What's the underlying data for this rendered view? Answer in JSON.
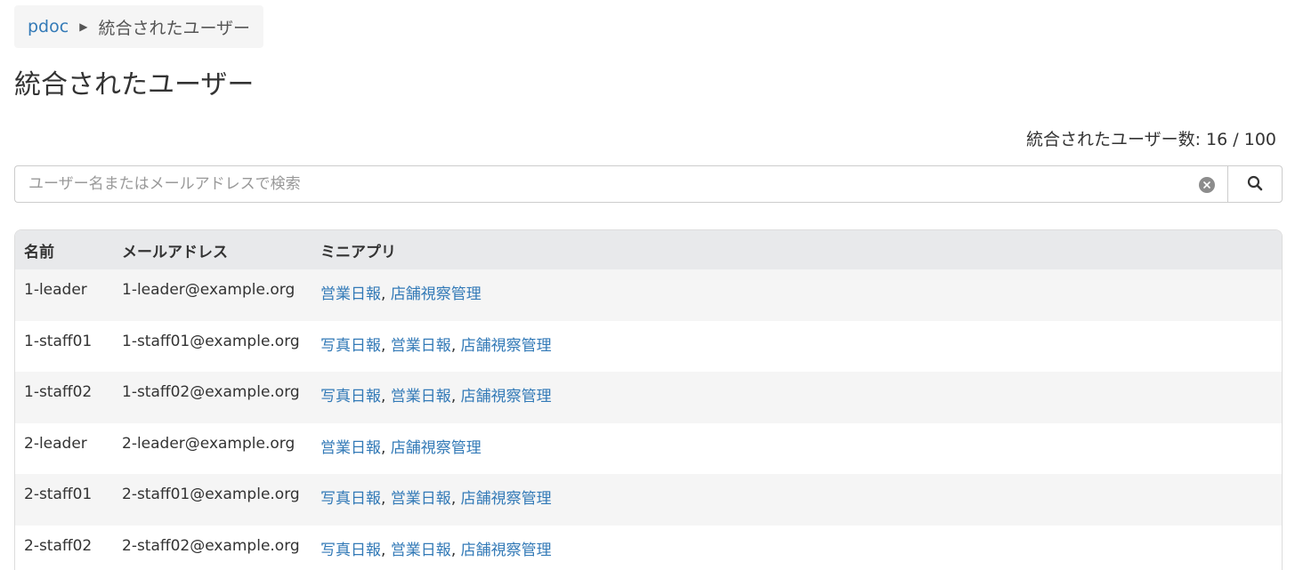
{
  "breadcrumb": {
    "home": "pdoc",
    "separator": "▶",
    "current": "統合されたユーザー"
  },
  "page_title": "統合されたユーザー",
  "count": {
    "label": "統合されたユーザー数:",
    "current": "16",
    "separator": "/",
    "max": "100"
  },
  "search": {
    "placeholder": "ユーザー名またはメールアドレスで検索",
    "value": "",
    "clear_icon": "clear-circle-x-icon",
    "button_icon": "search-icon"
  },
  "table": {
    "headers": [
      "名前",
      "メールアドレス",
      "ミニアプリ"
    ],
    "rows": [
      {
        "name": "1-leader",
        "email": "1-leader@example.org",
        "apps": [
          "営業日報",
          "店舗視察管理"
        ]
      },
      {
        "name": "1-staff01",
        "email": "1-staff01@example.org",
        "apps": [
          "写真日報",
          "営業日報",
          "店舗視察管理"
        ]
      },
      {
        "name": "1-staff02",
        "email": "1-staff02@example.org",
        "apps": [
          "写真日報",
          "営業日報",
          "店舗視察管理"
        ]
      },
      {
        "name": "2-leader",
        "email": "2-leader@example.org",
        "apps": [
          "営業日報",
          "店舗視察管理"
        ]
      },
      {
        "name": "2-staff01",
        "email": "2-staff01@example.org",
        "apps": [
          "写真日報",
          "営業日報",
          "店舗視察管理"
        ]
      },
      {
        "name": "2-staff02",
        "email": "2-staff02@example.org",
        "apps": [
          "写真日報",
          "営業日報",
          "店舗視察管理"
        ]
      }
    ]
  },
  "colors": {
    "link": "#337ab7",
    "text": "#333333",
    "header_bg": "#e8e9eb",
    "stripe_bg": "#f5f5f5"
  }
}
